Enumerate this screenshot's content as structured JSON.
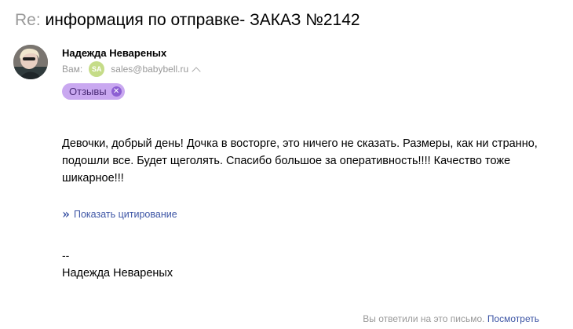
{
  "subject": {
    "prefix": "Re:",
    "title": "информация по отправке- ЗАКАЗ №2142"
  },
  "sender": {
    "name": "Надежда Невареных",
    "avatar_icon": "user-photo"
  },
  "recipient": {
    "label": "Вам:",
    "initials": "SA",
    "email": "sales@babybell.ru",
    "expand_icon": "chevron-up-icon"
  },
  "tag": {
    "label": "Отзывы",
    "remove_icon": "close-icon",
    "color": "#c9a8f0"
  },
  "message": {
    "body": "Девочки, добрый день! Дочка в восторге, это ничего не сказать. Размеры, как ни странно, подошли все. Будет щеголять. Спасибо большое за оперативность!!!! Качество тоже шикарное!!!",
    "show_quote_label": "Показать цитирование",
    "quote_icon": "»",
    "signature_dash": "--",
    "signature_name": "Надежда Невареных"
  },
  "footer": {
    "replied_text": "Вы ответили на это письмо.",
    "view_link": "Посмотреть"
  },
  "colors": {
    "link": "#3d55a5",
    "muted": "#999999",
    "badge": "#c5dc88"
  }
}
